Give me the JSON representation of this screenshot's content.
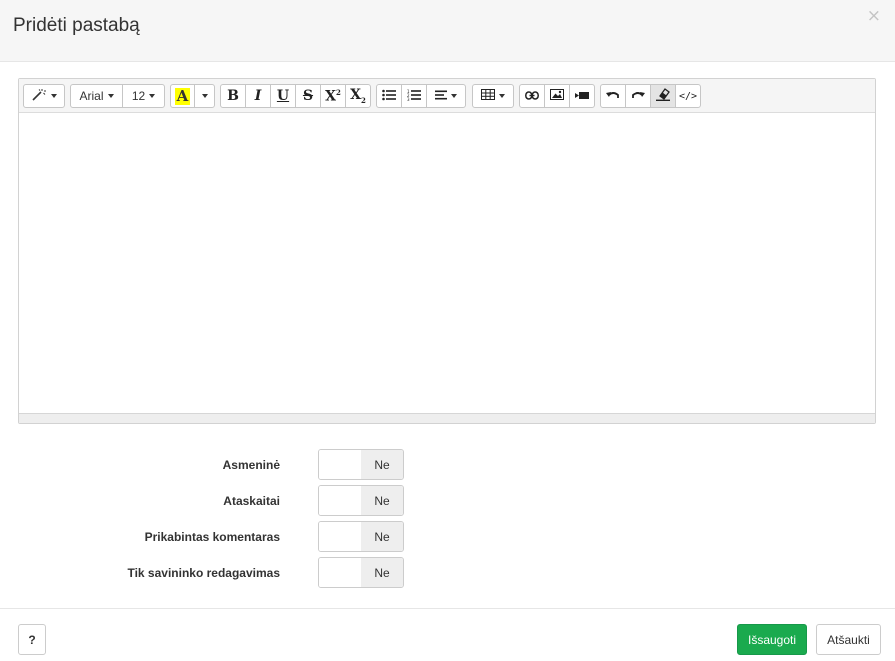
{
  "modal": {
    "title": "Pridėti pastabą",
    "close_label": "×"
  },
  "toolbar": {
    "font_name": "Arial",
    "font_size": "12",
    "color_letter": "A",
    "highlight_color": "#ffff00",
    "code_view_label": "</>",
    "bold_label": "B",
    "italic_label": "I",
    "underline_label": "U",
    "strike_label": "S",
    "superscript_label": "X",
    "subscript_label": "X"
  },
  "form": {
    "rows": [
      {
        "label": "Asmeninė",
        "toggle_value": "Ne"
      },
      {
        "label": "Ataskaitai",
        "toggle_value": "Ne"
      },
      {
        "label": "Prikabintas komentaras",
        "toggle_value": "Ne"
      },
      {
        "label": "Tik savininko redagavimas",
        "toggle_value": "Ne"
      }
    ]
  },
  "footer": {
    "help_label": "?",
    "save_label": "Išsaugoti",
    "cancel_label": "Atšaukti"
  },
  "colors": {
    "save_button": "#1aaa4e",
    "header_bg": "#f6f6f6"
  }
}
